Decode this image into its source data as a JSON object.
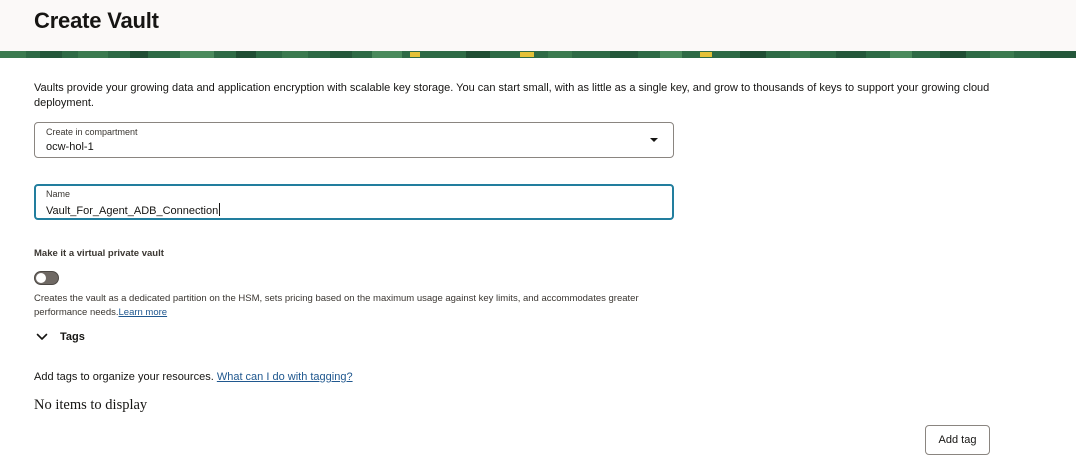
{
  "page": {
    "title": "Create Vault"
  },
  "intro": {
    "text": "Vaults provide your growing data and application encryption with scalable key storage. You can start small, with as little as a single key, and grow to thousands of keys to support your growing cloud deployment."
  },
  "compartment": {
    "label": "Create in compartment",
    "value": "ocw-hol-1",
    "icon": "chevron-down-icon"
  },
  "name_field": {
    "label": "Name",
    "value": "Vault_For_Agent_ADB_Connection",
    "focused": true
  },
  "virtual_private": {
    "label": "Make it a virtual private vault",
    "enabled": false,
    "help_text": "Creates the vault as a dedicated partition on the HSM, sets pricing based on the maximum usage against key limits, and accommodates greater performance needs.",
    "learn_more": "Learn more"
  },
  "tags": {
    "label": "Tags",
    "expanded": true,
    "description": "Add tags to organize your resources.",
    "help_link": "What can I do with tagging?",
    "empty_text": "No items to display",
    "add_button": "Add tag"
  },
  "colors": {
    "focus_border": "#227e9e",
    "link": "#20588f",
    "header_bg": "#fbf9f8",
    "banner_green": "#2e6a45",
    "banner_yellow": "#e3c138"
  }
}
